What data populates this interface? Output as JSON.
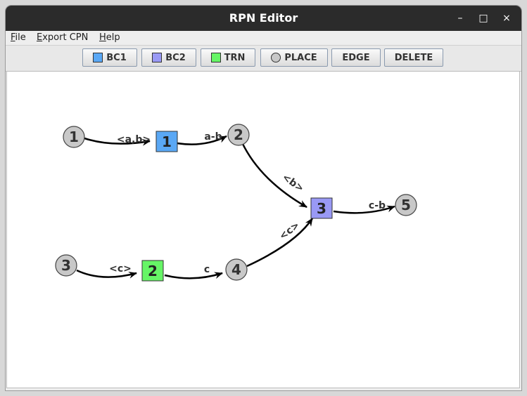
{
  "window": {
    "title": "RPN Editor"
  },
  "window_controls": {
    "minimize": "–",
    "maximize": "□",
    "close": "×"
  },
  "menu": {
    "file": {
      "mnemonic": "F",
      "rest": "ile"
    },
    "export": {
      "mnemonic": "E",
      "rest": "xport CPN"
    },
    "help": {
      "mnemonic": "H",
      "rest": "elp"
    }
  },
  "toolbar": {
    "bc1": {
      "label": "BC1",
      "color": "#5aa8f5"
    },
    "bc2": {
      "label": "BC2",
      "color": "#9999f5"
    },
    "trn": {
      "label": "TRN",
      "color": "#66f566"
    },
    "place": {
      "label": "PLACE",
      "color": "#c8c8c8"
    },
    "edge": {
      "label": "EDGE"
    },
    "delete": {
      "label": "DELETE"
    }
  },
  "graph": {
    "places": [
      {
        "id": "p1",
        "label": "1"
      },
      {
        "id": "p2",
        "label": "2"
      },
      {
        "id": "p3",
        "label": "3"
      },
      {
        "id": "p4",
        "label": "4"
      },
      {
        "id": "p5",
        "label": "5"
      }
    ],
    "transitions": [
      {
        "id": "t1",
        "label": "1",
        "type": "BC1",
        "color": "#5aa8f5"
      },
      {
        "id": "t2",
        "label": "2",
        "type": "TRN",
        "color": "#66f566"
      },
      {
        "id": "t3",
        "label": "3",
        "type": "BC2",
        "color": "#9999f5"
      }
    ],
    "edges": [
      {
        "id": "e1",
        "from": "p1",
        "to": "t1",
        "label": "<a,b>"
      },
      {
        "id": "e2",
        "from": "t1",
        "to": "p2",
        "label": "a-b"
      },
      {
        "id": "e3",
        "from": "p2",
        "to": "t3",
        "label": "<b>"
      },
      {
        "id": "e4",
        "from": "p3",
        "to": "t2",
        "label": "<c>"
      },
      {
        "id": "e5",
        "from": "t2",
        "to": "p4",
        "label": "c"
      },
      {
        "id": "e6",
        "from": "p4",
        "to": "t3",
        "label": "<c>"
      },
      {
        "id": "e7",
        "from": "t3",
        "to": "p5",
        "label": "c-b"
      }
    ]
  }
}
